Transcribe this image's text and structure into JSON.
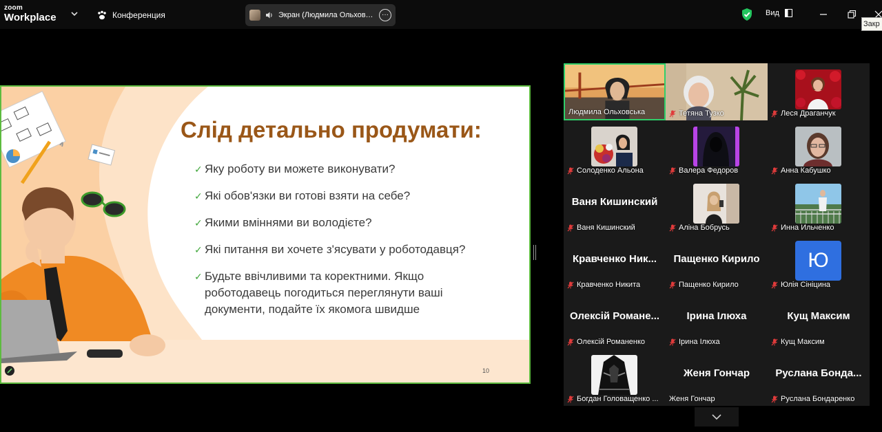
{
  "app": {
    "logo_line1": "zoom",
    "logo_line2": "Workplace"
  },
  "meeting": {
    "title": "Конференция"
  },
  "screen_share": {
    "label": "Экран (Людмила Ольховськ"
  },
  "view_menu": {
    "label": "Вид"
  },
  "tooltip": {
    "text": "Закр"
  },
  "slide": {
    "title": "Слід детально продумати:",
    "bullets": [
      "Яку роботу ви можете виконувати?",
      "Які обов'язки ви готові взяти на себе?",
      "Якими вміннями ви володієте?",
      "Які питання ви хочете з'ясувати у роботодавця?",
      "Будьте ввічливими та коректними. Якщо роботодавець погодиться переглянути ваші документи, подайте їх якомога швидше"
    ],
    "page_number": "10"
  },
  "participants": [
    {
      "name": "Людмила Ольховська",
      "video": "bridge",
      "muted": false,
      "active": true
    },
    {
      "name": "Тетяна Тузко",
      "video": "woman-plant",
      "muted": true
    },
    {
      "name": "Леся Драганчук",
      "video": "roses",
      "muted": true
    },
    {
      "name": "Солоденко Альона",
      "video": "flowers",
      "muted": true
    },
    {
      "name": "Валера Федоров",
      "video": "hood",
      "muted": true
    },
    {
      "name": "Анна Кабушко",
      "video": "woman-glasses",
      "muted": true
    },
    {
      "name": "Ваня Кишинский",
      "display_name": "Ваня Кишинский",
      "muted": true
    },
    {
      "name": "Аліна Бобрусь",
      "video": "selfie",
      "muted": true
    },
    {
      "name": "Инна Ильченко",
      "video": "balcony",
      "muted": true
    },
    {
      "name": "Кравченко Никита",
      "display_name": "Кравченко Ник...",
      "muted": true
    },
    {
      "name": "Пащенко Кирило",
      "display_name": "Пащенко Кирило",
      "muted": true
    },
    {
      "name": "Юлія Сініцина",
      "initial": "Ю",
      "muted": true
    },
    {
      "name": "Олексій Романенко",
      "display_name": "Олексій Романе...",
      "muted": true
    },
    {
      "name": "Ірина Ілюха",
      "display_name": "Ірина Ілюха",
      "muted": true
    },
    {
      "name": "Кущ Максим",
      "display_name": "Кущ Максим",
      "muted": true
    },
    {
      "name": "Богдан Головащенко ...",
      "video": "knight",
      "muted": true
    },
    {
      "name": "Женя Гончар",
      "display_name": "Женя Гончар",
      "muted": false
    },
    {
      "name": "Руслана Бондаренко",
      "display_name": "Руслана Бонда...",
      "muted": true
    }
  ],
  "colors": {
    "active_speaker": "#2fcf6a",
    "slide_border": "#5dbb3f",
    "title": "#9a5718",
    "muted_mic": "#e03b3b",
    "shield": "#22c55e"
  },
  "icons": [
    "chevron-down-icon",
    "paw-icon",
    "speaker-icon",
    "more-icon",
    "shield-icon",
    "view-icon",
    "minimize-icon",
    "restore-icon",
    "close-icon",
    "mic-muted-icon"
  ]
}
